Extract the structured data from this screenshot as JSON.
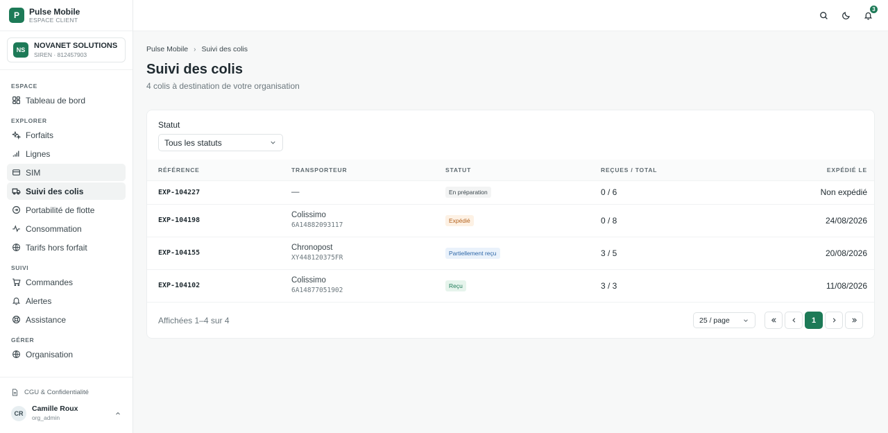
{
  "brand": {
    "logo_letter": "P",
    "name": "Pulse Mobile",
    "subtitle": "ESPACE CLIENT"
  },
  "org": {
    "initials": "NS",
    "name": "NOVANET SOLUTIONS",
    "siren": "SIREN · 812457903"
  },
  "nav": {
    "sections": [
      {
        "title": "ESPACE",
        "items": [
          {
            "label": "Tableau de bord",
            "icon": "dashboard-icon"
          }
        ]
      },
      {
        "title": "EXPLORER",
        "items": [
          {
            "label": "Forfaits",
            "icon": "sparkles-icon"
          },
          {
            "label": "Lignes",
            "icon": "signal-icon"
          },
          {
            "label": "SIM",
            "icon": "sim-card-icon"
          },
          {
            "label": "Suivi des colis",
            "icon": "truck-icon"
          },
          {
            "label": "Portabilité de flotte",
            "icon": "transfer-icon"
          },
          {
            "label": "Consommation",
            "icon": "activity-icon"
          },
          {
            "label": "Tarifs hors forfait",
            "icon": "globe-icon"
          }
        ]
      },
      {
        "title": "SUIVI",
        "items": [
          {
            "label": "Commandes",
            "icon": "cart-icon"
          },
          {
            "label": "Alertes",
            "icon": "bell-icon"
          },
          {
            "label": "Assistance",
            "icon": "lifebuoy-icon"
          }
        ]
      },
      {
        "title": "GÉRER",
        "items": [
          {
            "label": "Organisation",
            "icon": "building-icon"
          }
        ]
      }
    ]
  },
  "footer_links": {
    "cgu": "CGU & Confidentialité"
  },
  "user": {
    "initials": "CR",
    "name": "Camille Roux",
    "role": "org_admin"
  },
  "topbar": {
    "notifications_count": "3"
  },
  "breadcrumb": {
    "root": "Pulse Mobile",
    "current": "Suivi des colis"
  },
  "page": {
    "title": "Suivi des colis",
    "subtitle": "4 colis à destination de votre organisation"
  },
  "filter": {
    "label": "Statut",
    "value": "Tous les statuts"
  },
  "table": {
    "headers": {
      "ref": "RÉFÉRENCE",
      "carrier": "TRANSPORTEUR",
      "status": "STATUT",
      "received": "REÇUES / TOTAL",
      "shipped": "EXPÉDIÉ LE"
    },
    "rows": [
      {
        "ref": "EXP-104227",
        "carrier": "—",
        "tracking": "",
        "status": "En préparation",
        "status_kind": "prep",
        "received": "0 / 6",
        "shipped": "Non expédié"
      },
      {
        "ref": "EXP-104198",
        "carrier": "Colissimo",
        "tracking": "6A14882093117",
        "status": "Expédié",
        "status_kind": "exp",
        "received": "0 / 8",
        "shipped": "24/08/2026"
      },
      {
        "ref": "EXP-104155",
        "carrier": "Chronopost",
        "tracking": "XY448120375FR",
        "status": "Partiellement reçu",
        "status_kind": "part",
        "received": "3 / 5",
        "shipped": "20/08/2026"
      },
      {
        "ref": "EXP-104102",
        "carrier": "Colissimo",
        "tracking": "6A14877051902",
        "status": "Reçu",
        "status_kind": "recu",
        "received": "3 / 3",
        "shipped": "11/08/2026"
      }
    ]
  },
  "pagination": {
    "info": "Affichées 1–4 sur 4",
    "page_size": "25 / page",
    "current_page": "1"
  },
  "colors": {
    "accent": "#1d7a57",
    "expedie": "#b4621d",
    "partiel": "#2d66a7"
  }
}
